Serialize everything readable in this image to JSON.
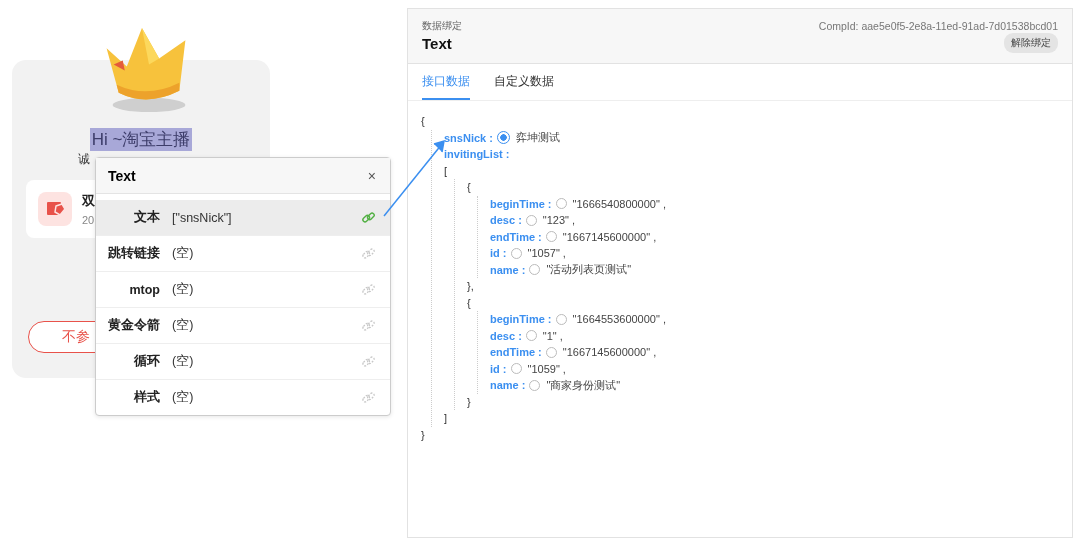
{
  "preview": {
    "greeting": "Hi ~淘宝主播",
    "subtitle": "诚",
    "card": {
      "title": "双",
      "date": "20"
    },
    "button": "不参"
  },
  "popup": {
    "title": "Text",
    "close": "×",
    "rows": [
      {
        "label": "文本",
        "value": "[\"snsNick\"]",
        "bound": true,
        "selected": true
      },
      {
        "label": "跳转链接",
        "value": "(空)",
        "bound": false,
        "selected": false
      },
      {
        "label": "mtop",
        "value": "(空)",
        "bound": false,
        "selected": false
      },
      {
        "label": "黄金令箭",
        "value": "(空)",
        "bound": false,
        "selected": false
      },
      {
        "label": "循环",
        "value": "(空)",
        "bound": false,
        "selected": false
      },
      {
        "label": "样式",
        "value": "(空)",
        "bound": false,
        "selected": false
      }
    ]
  },
  "panel": {
    "caption": "数据绑定",
    "title": "Text",
    "comp_id": "CompId: aae5e0f5-2e8a-11ed-91ad-7d01538bcd01",
    "unbind": "解除绑定",
    "tabs": [
      {
        "label": "接口数据",
        "selected": true
      },
      {
        "label": "自定义数据",
        "selected": false
      }
    ],
    "tree": {
      "open": "{",
      "close": "}",
      "children": [
        {
          "kind": "field",
          "key": "snsNick :",
          "selected": true,
          "value": "弈坤测试"
        },
        {
          "kind": "label",
          "key": "invitingList :"
        },
        {
          "kind": "block",
          "open": "[",
          "close": "]",
          "children": [
            {
              "kind": "block",
              "open": "{",
              "close": "},",
              "children": [
                {
                  "kind": "field",
                  "key": "beginTime :",
                  "selected": false,
                  "value": "\"1666540800000\" ,"
                },
                {
                  "kind": "field",
                  "key": "desc :",
                  "selected": false,
                  "value": "\"123\" ,"
                },
                {
                  "kind": "field",
                  "key": "endTime :",
                  "selected": false,
                  "value": "\"1667145600000\" ,"
                },
                {
                  "kind": "field",
                  "key": "id :",
                  "selected": false,
                  "value": "\"1057\" ,"
                },
                {
                  "kind": "field",
                  "key": "name :",
                  "selected": false,
                  "value": "\"活动列表页测试\""
                }
              ]
            },
            {
              "kind": "block",
              "open": "{",
              "close": "}",
              "children": [
                {
                  "kind": "field",
                  "key": "beginTime :",
                  "selected": false,
                  "value": "\"1664553600000\" ,"
                },
                {
                  "kind": "field",
                  "key": "desc :",
                  "selected": false,
                  "value": "\"1\" ,"
                },
                {
                  "kind": "field",
                  "key": "endTime :",
                  "selected": false,
                  "value": "\"1667145600000\" ,"
                },
                {
                  "kind": "field",
                  "key": "id :",
                  "selected": false,
                  "value": "\"1059\" ,"
                },
                {
                  "kind": "field",
                  "key": "name :",
                  "selected": false,
                  "value": "\"商家身份测试\""
                }
              ]
            }
          ]
        }
      ]
    }
  }
}
